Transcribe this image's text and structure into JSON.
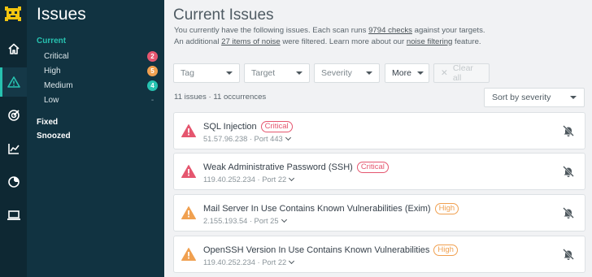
{
  "sidebar": {
    "title": "Issues",
    "current_label": "Current",
    "items": [
      {
        "label": "Critical",
        "count": "2",
        "severity": "critical"
      },
      {
        "label": "High",
        "count": "5",
        "severity": "high"
      },
      {
        "label": "Medium",
        "count": "4",
        "severity": "medium"
      },
      {
        "label": "Low",
        "count": "-",
        "severity": "low"
      }
    ],
    "fixed_label": "Fixed",
    "snoozed_label": "Snoozed"
  },
  "rail": {
    "icons": [
      "logo-icon",
      "home-icon",
      "warning-icon",
      "target-icon",
      "chart-icon",
      "radar-icon",
      "laptop-icon"
    ]
  },
  "main": {
    "title": "Current Issues",
    "intro": {
      "text1": "You currently have the following issues. Each scan runs ",
      "link1": "9794 checks",
      "text2": " against your targets.",
      "text3": "An additional ",
      "link2": "27 items of noise",
      "text4": " were filtered. Learn more about our ",
      "link3": "noise filtering",
      "text5": " feature."
    },
    "filters": {
      "tag": "Tag",
      "target": "Target",
      "severity": "Severity",
      "more": "More",
      "clear": "Clear all"
    },
    "count_text": "11 issues · 11 occurrences",
    "sort_label": "Sort by severity",
    "issues": [
      {
        "name": "SQL Injection",
        "severity": "Critical",
        "level": "critical",
        "meta": "51.57.96.238 · Port 443"
      },
      {
        "name": "Weak Administrative Password (SSH)",
        "severity": "Critical",
        "level": "critical",
        "meta": "119.40.252.234 · Port 22"
      },
      {
        "name": "Mail Server In Use Contains Known Vulnerabilities (Exim)",
        "severity": "High",
        "level": "high",
        "meta": "2.155.193.54 · Port 25"
      },
      {
        "name": "OpenSSH Version In Use Contains Known Vulnerabilities",
        "severity": "High",
        "level": "high",
        "meta": "119.40.252.234 · Port 22"
      }
    ]
  },
  "colors": {
    "accent": "#27c2b0",
    "critical": "#e5566f",
    "high": "#f0a050",
    "medium": "#27c2b0",
    "rail_bg": "#0e2833",
    "sidebar_bg": "#113341"
  }
}
